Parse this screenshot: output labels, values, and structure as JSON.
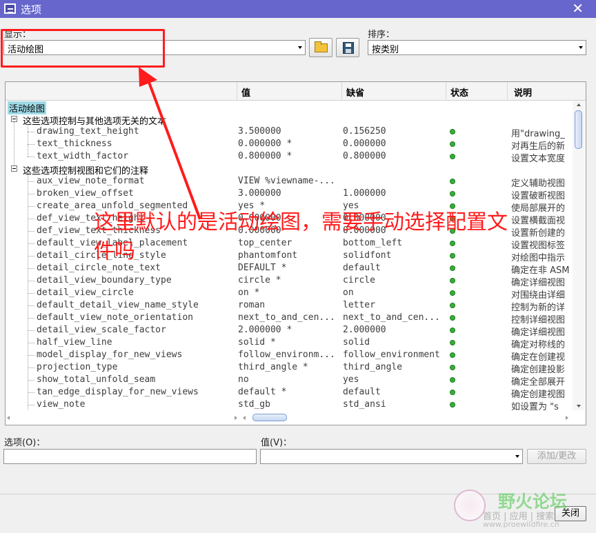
{
  "window": {
    "title": "选项",
    "close_glyph": "✕"
  },
  "show": {
    "label": "显示：",
    "value": "活动绘图"
  },
  "sort": {
    "label": "排序：",
    "value": "按类别"
  },
  "table": {
    "headers": [
      "值",
      "缺省",
      "状态",
      "说明"
    ],
    "root": "活动绘图",
    "groups": [
      "这些选项控制与其他选项无关的文本",
      "这些选项控制视图和它们的注释"
    ],
    "rows": [
      {
        "name": "drawing_text_height",
        "value": "3.500000",
        "default": "0.156250",
        "desc": "用\"drawing_"
      },
      {
        "name": "text_thickness",
        "value": "0.000000 *",
        "default": "0.000000",
        "desc": "对再生后的新"
      },
      {
        "name": "text_width_factor",
        "value": "0.800000 *",
        "default": "0.800000",
        "desc": "设置文本宽度"
      },
      {
        "name": "aux_view_note_format",
        "value": "VIEW %viewname-...",
        "default": "",
        "desc": "定义辅助视图"
      },
      {
        "name": "broken_view_offset",
        "value": "3.000000",
        "default": "1.000000",
        "desc": "设置破断视图"
      },
      {
        "name": "create_area_unfold_segmented",
        "value": "yes *",
        "default": "yes",
        "desc": "使局部展开的"
      },
      {
        "name": "def_view_text_height",
        "value": "0.000000",
        "default": "0.000000",
        "desc": "设置横截面视"
      },
      {
        "name": "def_view_text_thickness",
        "value": "0.000000",
        "default": "0.000000",
        "desc": "设置新创建的"
      },
      {
        "name": "default_view_label_placement",
        "value": "top_center",
        "default": "bottom_left",
        "desc": "设置视图标签"
      },
      {
        "name": "detail_circle_line_style",
        "value": "phantomfont",
        "default": "solidfont",
        "desc": "对绘图中指示"
      },
      {
        "name": "detail_circle_note_text",
        "value": "DEFAULT *",
        "default": "default",
        "desc": "确定在非 ASM"
      },
      {
        "name": "detail_view_boundary_type",
        "value": "circle *",
        "default": "circle",
        "desc": "确定详细视图"
      },
      {
        "name": "detail_view_circle",
        "value": "on *",
        "default": "on",
        "desc": "对围绕由详细"
      },
      {
        "name": "default_detail_view_name_style",
        "value": "roman",
        "default": "letter",
        "desc": "控制为新的详"
      },
      {
        "name": "default_view_note_orientation",
        "value": "next_to_and_cen...",
        "default": "next_to_and_cen...",
        "desc": "控制详细视图"
      },
      {
        "name": "detail_view_scale_factor",
        "value": "2.000000 *",
        "default": "2.000000",
        "desc": "确定详细视图"
      },
      {
        "name": "half_view_line",
        "value": "solid *",
        "default": "solid",
        "desc": "确定对称线的"
      },
      {
        "name": "model_display_for_new_views",
        "value": "follow_environm...",
        "default": "follow_environment",
        "desc": "确定在创建视"
      },
      {
        "name": "projection_type",
        "value": "third_angle *",
        "default": "third_angle",
        "desc": "确定创建投影"
      },
      {
        "name": "show_total_unfold_seam",
        "value": "no",
        "default": "yes",
        "desc": "确定全部展开"
      },
      {
        "name": "tan_edge_display_for_new_views",
        "value": "default *",
        "default": "default",
        "desc": "确定创建视图"
      },
      {
        "name": "view_note",
        "value": "std_gb",
        "default": "std_ansi",
        "desc": "如设置为 \"s"
      }
    ]
  },
  "option_field": {
    "label": "选项(O)：",
    "value": ""
  },
  "value_field": {
    "label": "值(V)：",
    "value": ""
  },
  "buttons": {
    "add_change": "添加/更改",
    "close": "关闭"
  },
  "annotation": {
    "text": "这里默认的是活动绘图，需要手动选择配置文件吗",
    "color": "#ff1b1b"
  },
  "watermark": {
    "title": "野火论坛",
    "links": "首页 | 应用 | 搜索",
    "url": "www.proewildfire.cn"
  },
  "colors": {
    "titlebar": "#6666cc",
    "status_ok": "#36b036",
    "root_highlight": "#9fdbe8"
  },
  "icons": [
    "app-icon",
    "close-icon",
    "open-folder-icon",
    "save-config-icon",
    "collapse-icon",
    "status-dot-icon"
  ]
}
